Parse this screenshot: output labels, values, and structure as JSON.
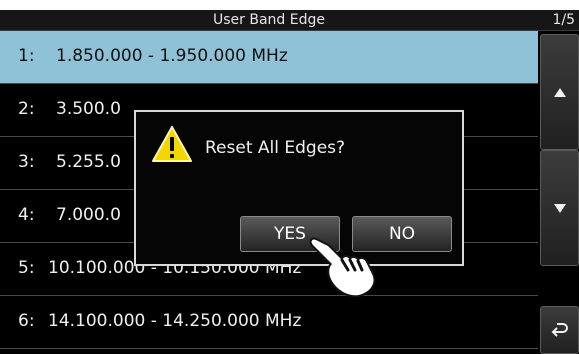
{
  "header": {
    "title": "User Band Edge",
    "page": "1/5"
  },
  "bands": [
    {
      "index": "1:",
      "range": "1.850.000 - 1.950.000 MHz"
    },
    {
      "index": "2:",
      "range": "3.500.0"
    },
    {
      "index": "3:",
      "range": "5.255.0"
    },
    {
      "index": "4:",
      "range": "7.000.0"
    },
    {
      "index": "5:",
      "range": "10.100.000 - 10.150.000 MHz"
    },
    {
      "index": "6:",
      "range": "14.100.000 - 14.250.000 MHz"
    }
  ],
  "dialog": {
    "message": "Reset All Edges?",
    "yes_label": "YES",
    "no_label": "NO",
    "icon": "warning-icon"
  },
  "sidebar": {
    "up_icon": "triangle-up-icon",
    "down_icon": "triangle-down-icon",
    "back_icon": "return-arrow-icon"
  },
  "colors": {
    "selected_row": "#8fc2d6",
    "background": "#000000",
    "warning": "#f2d600"
  }
}
